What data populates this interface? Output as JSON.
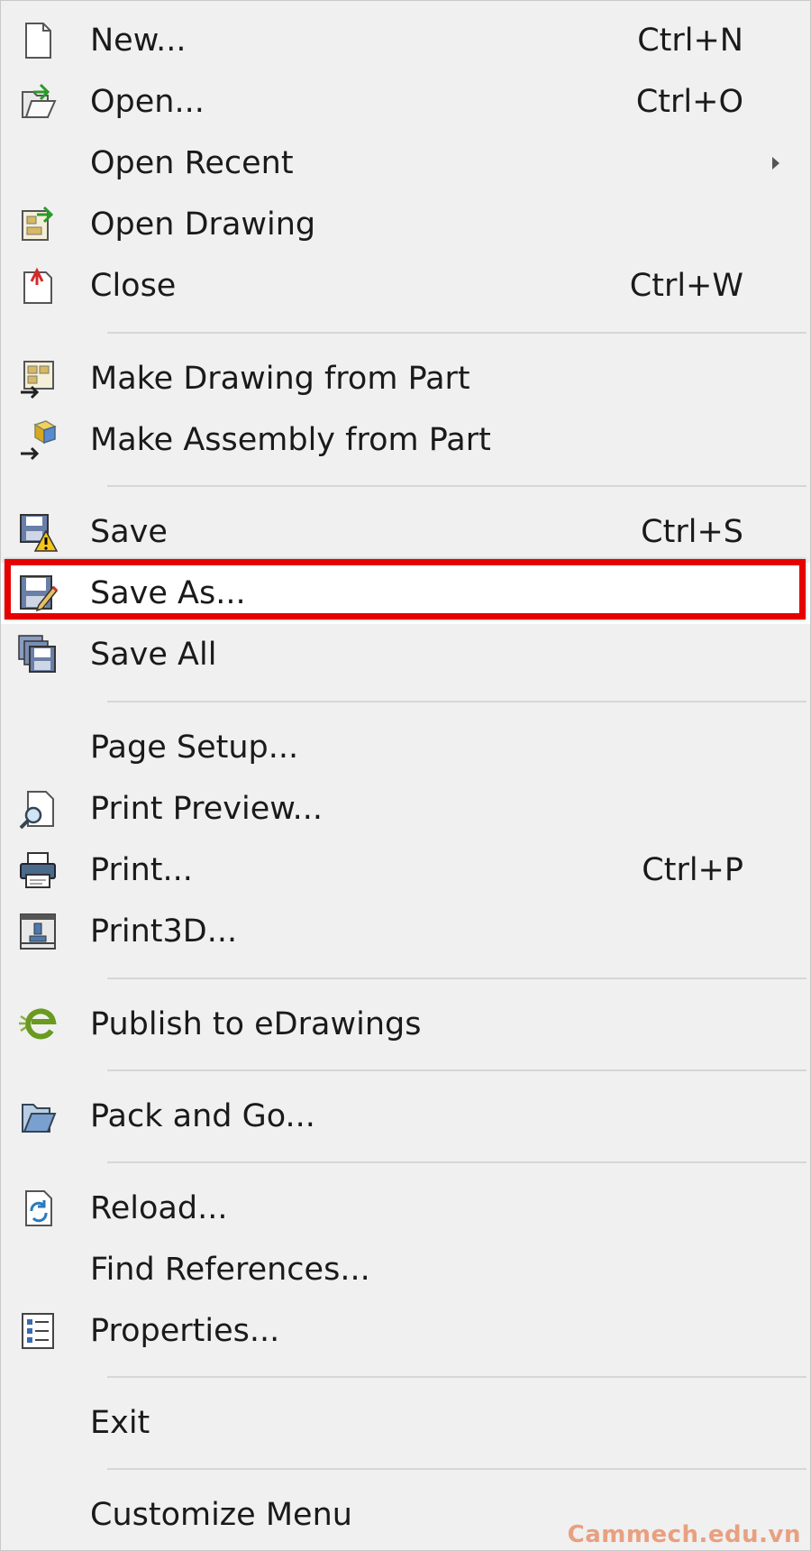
{
  "menu": {
    "items": [
      {
        "label": "New...",
        "shortcut": "Ctrl+N",
        "icon": "new-document-icon"
      },
      {
        "label": "Open...",
        "shortcut": "Ctrl+O",
        "icon": "open-folder-icon"
      },
      {
        "label": "Open Recent",
        "shortcut": "",
        "icon": "",
        "submenu": true
      },
      {
        "label": "Open Drawing",
        "shortcut": "",
        "icon": "open-drawing-icon"
      },
      {
        "label": "Close",
        "shortcut": "Ctrl+W",
        "icon": "close-document-icon"
      },
      {
        "label": "Make Drawing from Part",
        "shortcut": "",
        "icon": "make-drawing-icon"
      },
      {
        "label": "Make Assembly from Part",
        "shortcut": "",
        "icon": "make-assembly-icon"
      },
      {
        "label": "Save",
        "shortcut": "Ctrl+S",
        "icon": "save-warning-icon"
      },
      {
        "label": "Save As...",
        "shortcut": "",
        "icon": "save-as-icon",
        "highlighted": true
      },
      {
        "label": "Save All",
        "shortcut": "",
        "icon": "save-all-icon"
      },
      {
        "label": "Page Setup...",
        "shortcut": "",
        "icon": ""
      },
      {
        "label": "Print Preview...",
        "shortcut": "",
        "icon": "print-preview-icon"
      },
      {
        "label": "Print...",
        "shortcut": "Ctrl+P",
        "icon": "printer-icon"
      },
      {
        "label": "Print3D...",
        "shortcut": "",
        "icon": "print3d-icon"
      },
      {
        "label": "Publish to eDrawings",
        "shortcut": "",
        "icon": "edrawings-icon"
      },
      {
        "label": "Pack and Go...",
        "shortcut": "",
        "icon": "pack-and-go-icon"
      },
      {
        "label": "Reload...",
        "shortcut": "",
        "icon": "reload-icon"
      },
      {
        "label": "Find References...",
        "shortcut": "",
        "icon": ""
      },
      {
        "label": "Properties...",
        "shortcut": "",
        "icon": "properties-icon"
      },
      {
        "label": "Exit",
        "shortcut": "",
        "icon": ""
      },
      {
        "label": "Customize Menu",
        "shortcut": "",
        "icon": ""
      }
    ]
  },
  "colors": {
    "highlight_border": "#e60000",
    "menu_background": "#f0f0f0",
    "watermark": "#e8a080"
  },
  "watermark": "Cammech.edu.vn"
}
